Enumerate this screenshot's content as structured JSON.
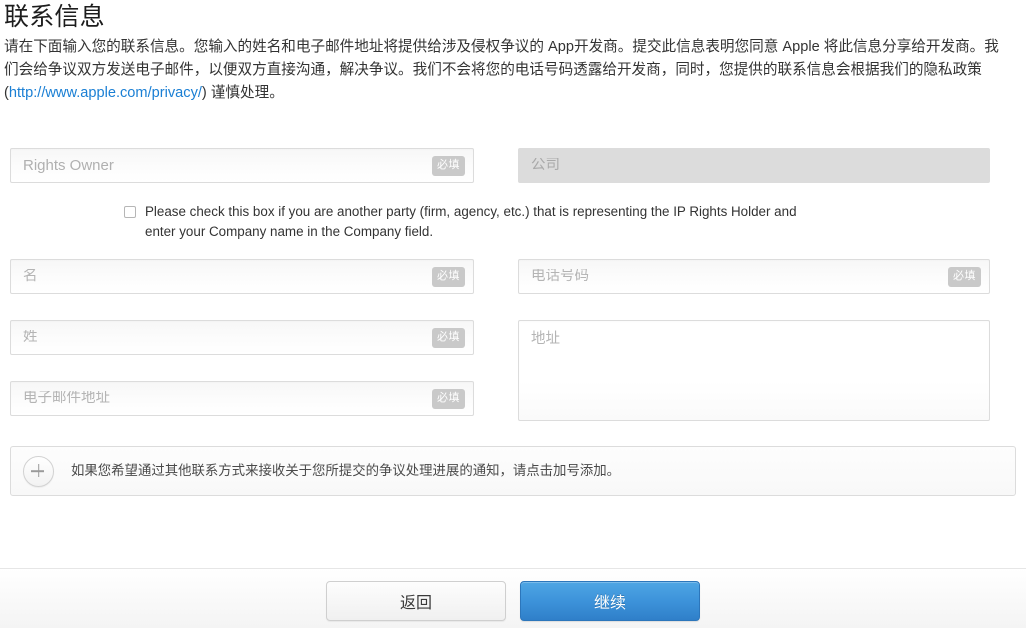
{
  "header": {
    "title": "联系信息",
    "intro_part1": "请在下面输入您的联系信息。您输入的姓名和电子邮件地址将提供给涉及侵权争议的 App开发商。提交此信息表明您同意 Apple 将此信息分享给开发商。我们会给争议双方发送电子邮件，以便双方直接沟通，解决争议。我们不会将您的电话号码透露给开发商，同时，您提供的联系信息会根据我们的隐私政策 (",
    "privacy_link_text": "http://www.apple.com/privacy/",
    "intro_part2": ") 谨慎处理。",
    "link_color": "#1a7fd4"
  },
  "form": {
    "required_badge": "必填",
    "rights_owner": {
      "placeholder": "Rights Owner",
      "value": "",
      "required": true
    },
    "company": {
      "placeholder": "公司",
      "value": "",
      "required": false,
      "disabled": true
    },
    "first_name": {
      "placeholder": "名",
      "value": "",
      "required": true
    },
    "last_name": {
      "placeholder": "姓",
      "value": "",
      "required": true
    },
    "email": {
      "placeholder": "电子邮件地址",
      "value": "",
      "required": true
    },
    "phone": {
      "placeholder": "电话号码",
      "value": "",
      "required": true
    },
    "address": {
      "placeholder": "地址",
      "value": "",
      "required": false
    },
    "agency_checkbox": {
      "label": "Please check this box if you are another party (firm, agency, etc.) that is representing the IP Rights Holder and enter your Company name in the Company field.",
      "checked": false
    }
  },
  "add_contact": {
    "icon": "plus-icon",
    "text": "如果您希望通过其他联系方式来接收关于您所提交的争议处理进展的通知，请点击加号添加。"
  },
  "footer": {
    "back_label": "返回",
    "continue_label": "继续",
    "primary_color": "#3d93da"
  }
}
